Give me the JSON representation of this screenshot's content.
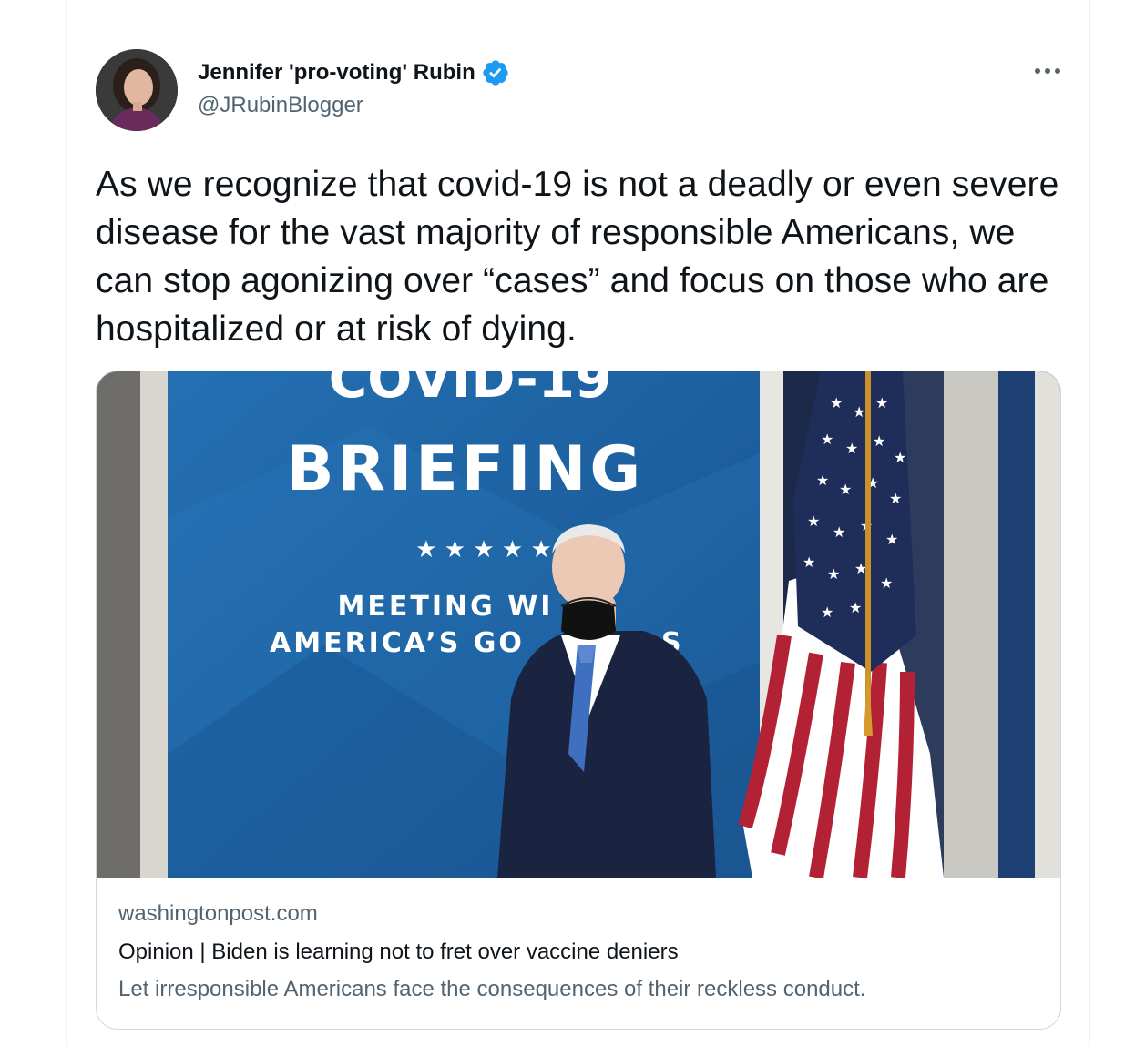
{
  "author": {
    "display_name": "Jennifer 'pro-voting' Rubin",
    "handle": "@JRubinBlogger",
    "verified": true,
    "avatar_icon": "profile-photo"
  },
  "menu": {
    "icon": "more-horizontal-icon"
  },
  "tweet": {
    "text": "As we recognize that covid-19 is not a deadly or even severe disease for the vast majority of responsible Americans, we can stop agonizing over “cases” and focus on those who are hospitalized or at risk of dying."
  },
  "card": {
    "image": {
      "banner_line1": "COVID-19",
      "banner_line2": "BRIEFING",
      "banner_stars": "★ ★ ★ ★ ★",
      "banner_line3": "MEETING WI",
      "banner_line4": "AMERICA’S GO",
      "banner_line4b": "S"
    },
    "domain": "washingtonpost.com",
    "title": "Opinion | Biden is learning not to fret over vaccine deniers",
    "description": "Let irresponsible Americans face the consequences of their reckless conduct."
  },
  "colors": {
    "text_primary": "#0f1419",
    "text_secondary": "#536471",
    "verified_blue": "#1d9bf0",
    "border": "#cfd9de",
    "backdrop_blue": "#1f5e9e"
  }
}
